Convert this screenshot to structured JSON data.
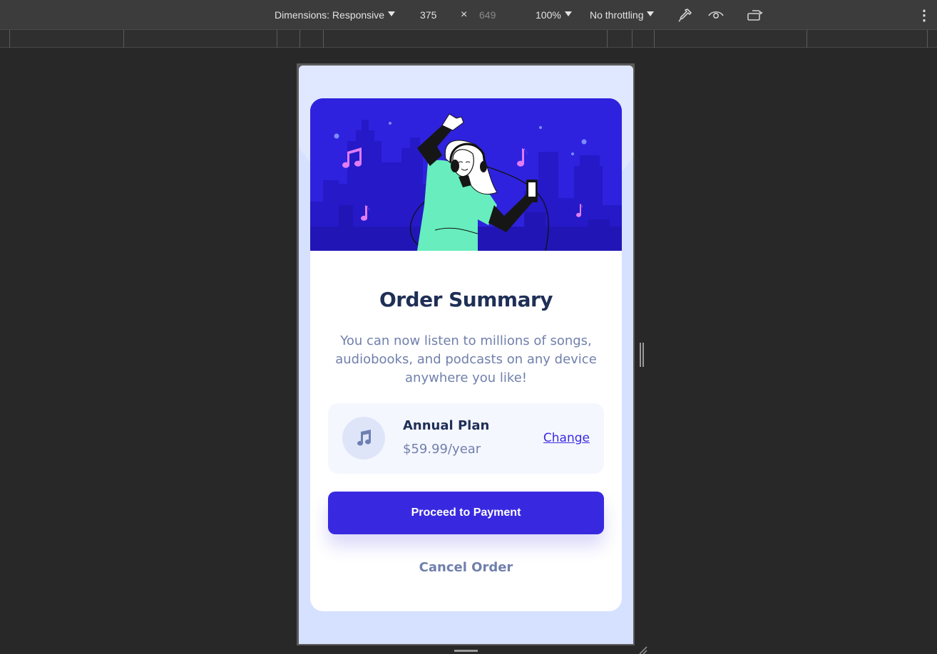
{
  "devtools": {
    "dimensions_label": "Dimensions: Responsive",
    "width_value": "375",
    "times_glyph": "×",
    "height_value": "649",
    "zoom": "100%",
    "throttling": "No throttling",
    "more_glyph": "⋮"
  },
  "card": {
    "title": "Order Summary",
    "description": "You can now listen to millions of songs, audiobooks, and podcasts on any device anywhere you like!",
    "plan": {
      "name": "Annual Plan",
      "price": "$59.99/year",
      "change_label": "Change"
    },
    "pay_label": "Proceed to Payment",
    "cancel_label": "Cancel Order"
  },
  "colors": {
    "primary": "#3829e0",
    "title": "#1f2f56",
    "muted": "#7180ac",
    "page_bg": "#d6e0ff",
    "plan_bg": "#f5f7ff"
  },
  "icons": {
    "eyedropper": "eyedropper-icon",
    "vision": "eye-icon",
    "rotate": "rotate-device-icon",
    "plan": "music-note-icon"
  }
}
